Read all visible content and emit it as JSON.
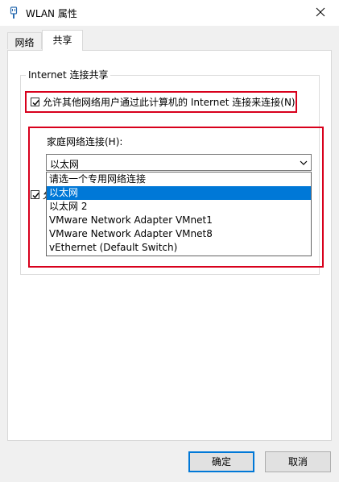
{
  "window": {
    "title": "WLAN 属性",
    "close_glyph": "✕"
  },
  "tabs": [
    {
      "label": "网络"
    },
    {
      "label": "共享"
    }
  ],
  "ics": {
    "group_title": "Internet 连接共享",
    "allow_connect_label": "允许其他网络用户通过此计算机的 Internet 连接来连接(N)",
    "allow_connect_checked": true,
    "home_network_label": "家庭网络连接(H):",
    "combo_value": "以太网",
    "second_checkbox_checked": true,
    "second_checkbox_partial": "允",
    "dropdown_options": [
      "请选一个专用网络连接",
      "以太网",
      "以太网 2",
      "VMware Network Adapter VMnet1",
      "VMware Network Adapter VMnet8",
      "vEthernet (Default Switch)"
    ],
    "selected_option": "以太网"
  },
  "buttons": {
    "ok": "确定",
    "cancel": "取消"
  },
  "colors": {
    "highlight": "#d8001c",
    "selection": "#0078d7"
  }
}
